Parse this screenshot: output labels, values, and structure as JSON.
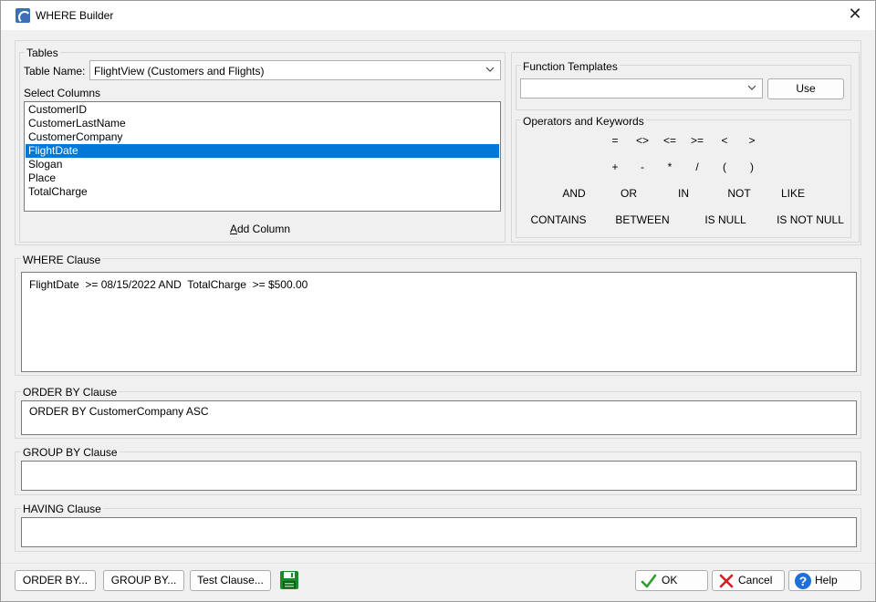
{
  "window": {
    "title": "WHERE Builder",
    "close_glyph": "✕"
  },
  "tables": {
    "group_label": "Tables",
    "table_name_label": "Table Name:",
    "table_name_value": "FlightView  (Customers and Flights)",
    "select_columns_label": "Select Columns",
    "columns": [
      "CustomerID",
      "CustomerLastName",
      "CustomerCompany",
      "FlightDate",
      "Slogan",
      "Place",
      "TotalCharge"
    ],
    "selected_index": 3,
    "add_column_prefix": "A",
    "add_column_rest": "dd Column"
  },
  "function_templates": {
    "group_label": "Function Templates",
    "value": "",
    "use_label": "Use"
  },
  "operators": {
    "group_label": "Operators and Keywords",
    "row1": [
      "=",
      "<>",
      "<=",
      ">=",
      "<",
      ">"
    ],
    "row2": [
      "+",
      "-",
      "*",
      "/",
      "(",
      ")"
    ],
    "row3": [
      "AND",
      "OR",
      "IN",
      "NOT",
      "LIKE"
    ],
    "row4": [
      "CONTAINS",
      "BETWEEN",
      "IS NULL",
      "IS NOT NULL"
    ]
  },
  "where_clause": {
    "label": "WHERE Clause",
    "text": "FlightDate  >= 08/15/2022 AND  TotalCharge  >= $500.00"
  },
  "order_by_clause": {
    "label": "ORDER BY Clause",
    "text": "ORDER BY CustomerCompany ASC"
  },
  "group_by_clause": {
    "label": "GROUP BY Clause",
    "text": ""
  },
  "having_clause": {
    "label": "HAVING Clause",
    "text": ""
  },
  "footer": {
    "order_by_btn": "ORDER BY...",
    "group_by_btn": "GROUP BY...",
    "test_clause_btn": "Test Clause...",
    "ok_btn": "OK",
    "cancel_btn": "Cancel",
    "help_btn": "Help"
  },
  "colors": {
    "selection": "#0078d7",
    "ok_check": "#2e9e2e",
    "cancel_x": "#d32020",
    "help_blue": "#1e6fd9",
    "save_green": "#1a8a2a"
  },
  "icons": [
    "app-icon",
    "close-icon",
    "chevron-down-icon",
    "save-icon",
    "checkmark-icon",
    "cancel-x-icon",
    "help-icon"
  ]
}
